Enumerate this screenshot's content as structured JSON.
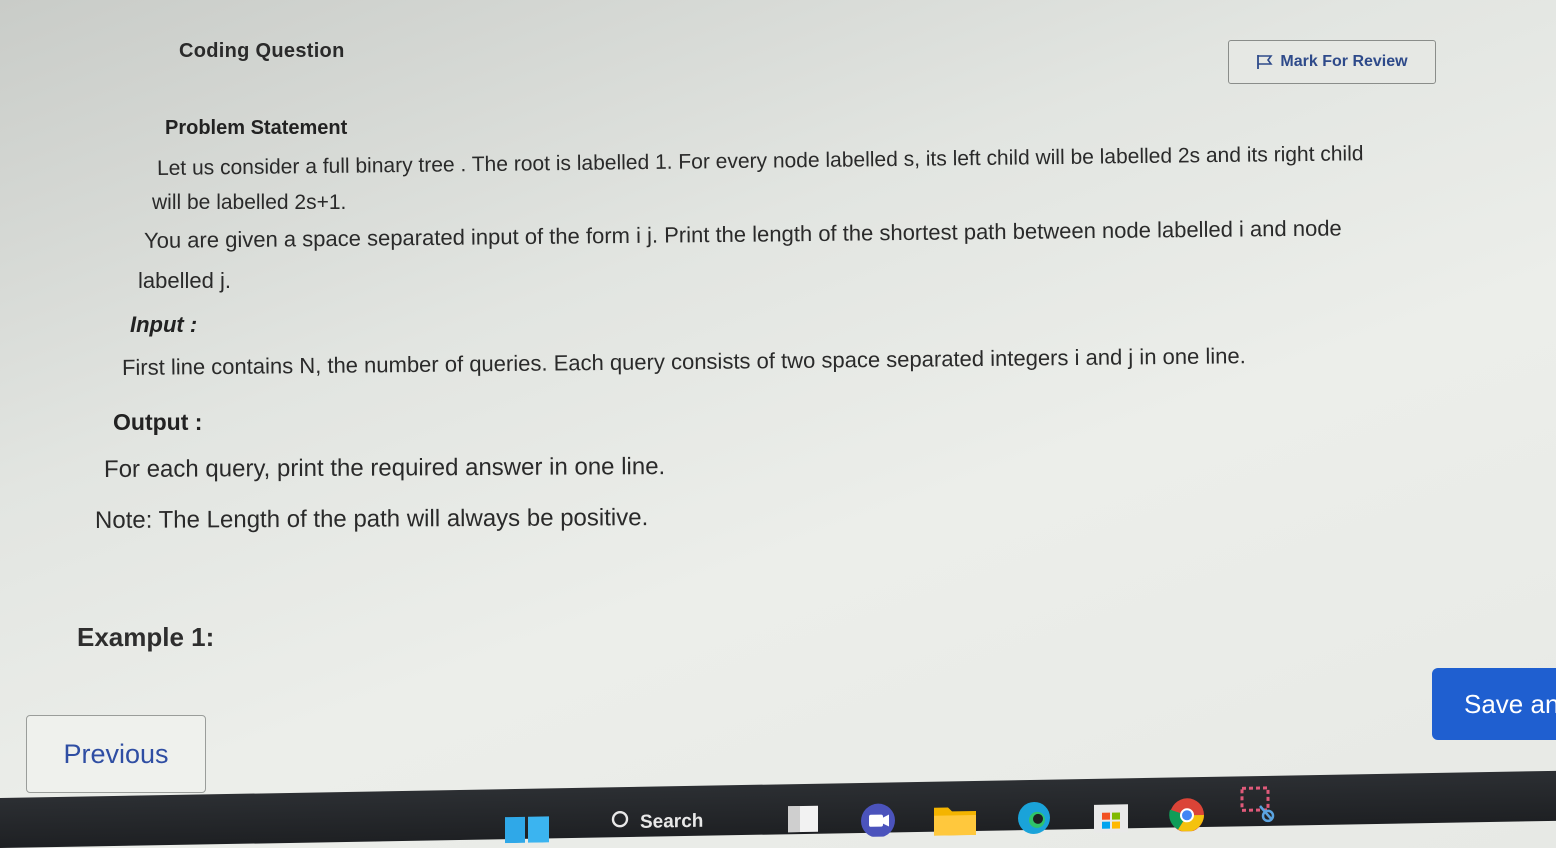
{
  "header": {
    "title": "Coding Question",
    "mark_for_review_label": "Mark For Review"
  },
  "problem": {
    "heading": "Problem Statement",
    "paragraph1_line1": "Let us consider a full binary tree . The root is labelled 1. For every node labelled s,  its left child will be labelled 2s and its right child",
    "paragraph1_line2": "will be labelled 2s+1.",
    "paragraph2_line1": "You are given a space separated input of the form i j.  Print the length of the shortest path between node labelled i and node",
    "paragraph2_line2": "labelled j.",
    "input_label": "Input :",
    "input_text": "First line contains N, the number of queries. Each query consists of two space separated integers i and j in one line.",
    "output_label": "Output :",
    "output_text": "For each query, print the required answer in one line.",
    "note_text": "Note: The Length of the path will always be positive.",
    "example_label": "Example 1:"
  },
  "navigation": {
    "previous_label": "Previous",
    "save_label": "Save an"
  },
  "taskbar": {
    "search_label": "Search",
    "icons": [
      "windows-start",
      "search",
      "task-view",
      "teams",
      "file-explorer",
      "edge",
      "store",
      "chrome",
      "snipping-tool"
    ]
  },
  "colors": {
    "accent_blue": "#1f5fd0",
    "link_blue": "#2f4ea3",
    "taskbar": "#1e2023"
  }
}
